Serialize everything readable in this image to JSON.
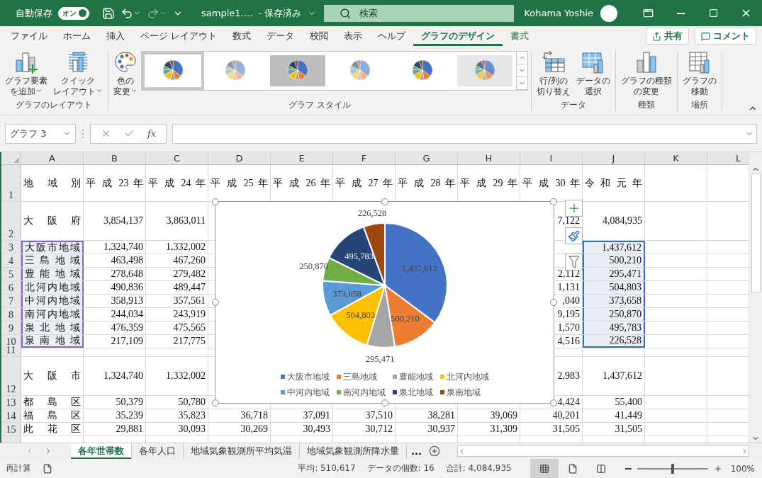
{
  "title_bar": {
    "autosave": {
      "label": "自動保存",
      "toggle": "オン",
      "on": true
    },
    "file_name": "sample1.…",
    "save_status": "- 保存済み",
    "search": {
      "placeholder": "検索"
    },
    "user": "Kohama Yoshie"
  },
  "ribbon": {
    "tabs": [
      {
        "label": "ファイル",
        "selected": false,
        "contextual": false
      },
      {
        "label": "ホーム",
        "selected": false,
        "contextual": false
      },
      {
        "label": "挿入",
        "selected": false,
        "contextual": false
      },
      {
        "label": "ページ レイアウト",
        "selected": false,
        "contextual": false
      },
      {
        "label": "数式",
        "selected": false,
        "contextual": false
      },
      {
        "label": "データ",
        "selected": false,
        "contextual": false
      },
      {
        "label": "校閲",
        "selected": false,
        "contextual": false
      },
      {
        "label": "表示",
        "selected": false,
        "contextual": false
      },
      {
        "label": "ヘルプ",
        "selected": false,
        "contextual": false
      },
      {
        "label": "グラフのデザイン",
        "selected": true,
        "contextual": true
      },
      {
        "label": "書式",
        "selected": false,
        "contextual": true
      }
    ],
    "share": "共有",
    "comment": "コメント",
    "groups": [
      {
        "label": "グラフのレイアウト",
        "buttons": [
          {
            "kind": "add-element",
            "lines": [
              "グラフ要素",
              "を追加"
            ],
            "dropdown": true
          },
          {
            "kind": "quick-layout",
            "lines": [
              "クイック",
              "レイアウト"
            ],
            "dropdown": true
          }
        ]
      },
      {
        "label": "グラフ スタイル",
        "buttons": [
          {
            "kind": "colors",
            "lines": [
              "色の",
              "変更"
            ],
            "dropdown": true
          }
        ],
        "gallery": [
          {
            "kind": "plain",
            "selected": true
          },
          {
            "kind": "hatched",
            "selected": false
          },
          {
            "kind": "dark",
            "selected": false
          },
          {
            "kind": "light",
            "selected": false
          },
          {
            "kind": "plain",
            "selected": false
          },
          {
            "kind": "striped",
            "selected": false
          }
        ]
      },
      {
        "label": "データ",
        "buttons": [
          {
            "kind": "switch",
            "lines": [
              "行/列の",
              "切り替え"
            ],
            "dropdown": false
          },
          {
            "kind": "select-data",
            "lines": [
              "データの",
              "選択"
            ],
            "dropdown": false
          }
        ]
      },
      {
        "label": "種類",
        "buttons": [
          {
            "kind": "change-type",
            "lines": [
              "グラフの種類",
              "の変更"
            ],
            "dropdown": false
          }
        ]
      },
      {
        "label": "場所",
        "buttons": [
          {
            "kind": "move",
            "lines": [
              "グラフの",
              "移動"
            ],
            "dropdown": false
          }
        ]
      }
    ]
  },
  "formula_bar": {
    "name_box": "グラフ 3",
    "function_label": "fx"
  },
  "grid": {
    "columns": [
      "A",
      "B",
      "C",
      "D",
      "E",
      "F",
      "G",
      "H",
      "I",
      "J",
      "K",
      "L"
    ],
    "rows": [
      {
        "number": "1",
        "kind": "title",
        "cells": {
          "A": "地 域 別",
          "B": "平 成 23 年",
          "C": "平 成 24 年",
          "D": "平 成 25 年",
          "E": "平 成 26 年",
          "F": "平 成 27 年",
          "G": "平 成 28 年",
          "H": "平 成 29 年",
          "I": "平 成 30 年",
          "J": "令 和 元 年"
        }
      },
      {
        "number": "2",
        "kind": "total",
        "cells": {
          "A": "大 阪 府",
          "B": "3,854,137",
          "C": "3,863,011",
          "I": "7,122",
          "J": "4,084,935"
        }
      },
      {
        "number": "3",
        "kind": "normal",
        "cells": {
          "A": {
            "text": "大阪市地域",
            "color": "#8a63c4"
          },
          "B": "1,324,740",
          "C": "1,332,002",
          "J": {
            "text": "1,437,612",
            "color": "#2f6bd1"
          }
        }
      },
      {
        "number": "4",
        "kind": "normal",
        "cells": {
          "A": {
            "text": "三 島 地 域",
            "color": "#8a63c4"
          },
          "B": "463,498",
          "C": "467,260",
          "J": {
            "text": "500,210",
            "color": "#2f6bd1"
          }
        }
      },
      {
        "number": "5",
        "kind": "normal",
        "cells": {
          "A": {
            "text": "豊 能 地 域",
            "color": "#8a63c4"
          },
          "B": "278,648",
          "C": "279,482",
          "I": "2,112",
          "J": {
            "text": "295,471",
            "color": "#2f6bd1"
          }
        }
      },
      {
        "number": "6",
        "kind": "normal",
        "cells": {
          "A": {
            "text": "北河内地域",
            "color": "#8a63c4"
          },
          "B": "490,836",
          "C": "489,447",
          "I": "1,131",
          "J": {
            "text": "504,803",
            "color": "#2f6bd1"
          }
        }
      },
      {
        "number": "7",
        "kind": "normal",
        "cells": {
          "A": {
            "text": "中河内地域",
            "color": "#8a63c4"
          },
          "B": "358,913",
          "C": "357,561",
          "I": ",040",
          "J": {
            "text": "373,658",
            "color": "#2f6bd1"
          }
        }
      },
      {
        "number": "8",
        "kind": "normal",
        "cells": {
          "A": {
            "text": "南河内地域",
            "color": "#8a63c4"
          },
          "B": "244,034",
          "C": "243,919",
          "I": "9,195",
          "J": {
            "text": "250,870",
            "color": "#2f6bd1"
          }
        }
      },
      {
        "number": "9",
        "kind": "normal",
        "cells": {
          "A": {
            "text": "泉 北 地 域",
            "color": "#8a63c4"
          },
          "B": "476,359",
          "C": "475,565",
          "I": "1,570",
          "J": {
            "text": "495,783",
            "color": "#2f6bd1"
          }
        }
      },
      {
        "number": "10",
        "kind": "normal",
        "cells": {
          "A": {
            "text": "泉 南 地 域",
            "color": "#8a63c4"
          },
          "B": "217,109",
          "C": "217,775",
          "I": "4,516",
          "J": {
            "text": "226,528",
            "color": "#2f6bd1"
          }
        }
      },
      {
        "number": "11",
        "kind": "gap",
        "cells": {}
      },
      {
        "number": "12",
        "kind": "total",
        "cells": {
          "A": "大 阪 市",
          "B": "1,324,740",
          "C": "1,332,002",
          "I": "2,983",
          "J": "1,437,612"
        }
      },
      {
        "number": "13",
        "kind": "normal",
        "cells": {
          "A": "都 島 区",
          "B": "50,379",
          "C": "50,780",
          "I": "4,424",
          "J": "55,400"
        }
      },
      {
        "number": "14",
        "kind": "normal",
        "cells": {
          "A": "福 島 区",
          "B": "35,239",
          "C": "35,823",
          "D": "36,718",
          "E": "37,091",
          "F": "37,510",
          "G": "38,281",
          "H": "39,069",
          "I": "40,201",
          "J": "41,449"
        }
      },
      {
        "number": "15",
        "kind": "normal",
        "cells": {
          "A": "此 花 区",
          "B": "29,881",
          "C": "30,093",
          "D": "30,269",
          "E": "30,493",
          "F": "30,712",
          "G": "30,937",
          "H": "31,309",
          "I": "31,505",
          "J": "31,505"
        }
      }
    ]
  },
  "chart": {
    "chart_data": {
      "type": "pie",
      "categories": [
        "大阪市地域",
        "三島地域",
        "豊能地域",
        "北河内地域",
        "中河内地域",
        "南河内地域",
        "泉北地域",
        "泉南地域"
      ],
      "values": [
        1437612,
        500210,
        295471,
        504803,
        373658,
        250870,
        495783,
        226528
      ],
      "value_labels": [
        "1,437,612",
        "500,210",
        "295,471",
        "504,803",
        "373,658",
        "250,870",
        "495,783",
        "226,528"
      ],
      "colors": [
        "#4472c4",
        "#ed7d31",
        "#a5a5a5",
        "#ffc000",
        "#5b9bd5",
        "#70ad47",
        "#264478",
        "#9e480e"
      ],
      "data_labels": true,
      "legend": "bottom"
    }
  },
  "sheet_tabs": {
    "tabs": [
      {
        "label": "各年世帯数",
        "selected": true
      },
      {
        "label": "各年人口",
        "selected": false
      },
      {
        "label": "地域気象観測所平均気温",
        "selected": false
      },
      {
        "label": "地域気象観測所降水量",
        "selected": false
      }
    ],
    "more": "..."
  },
  "status_bar": {
    "mode": "再計算",
    "average": "平均: 510,617",
    "count": "データの個数: 16",
    "sum": "合計: 4,084,935",
    "views": [
      {
        "kind": "normal",
        "selected": true
      },
      {
        "kind": "page-layout",
        "selected": false
      },
      {
        "kind": "page-break",
        "selected": false
      }
    ],
    "zoom": {
      "level": 0.5,
      "label": "100%"
    }
  }
}
